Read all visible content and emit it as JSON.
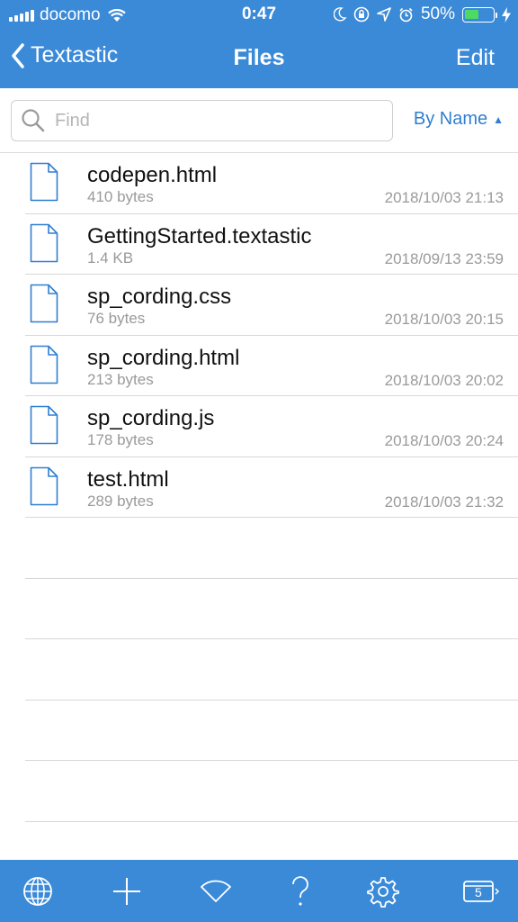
{
  "status": {
    "carrier": "docomo",
    "time": "0:47",
    "battery_percent": "50%",
    "battery_level": 0.5
  },
  "nav": {
    "back_label": "Textastic",
    "title": "Files",
    "edit_label": "Edit"
  },
  "search": {
    "placeholder": "Find",
    "value": ""
  },
  "sort": {
    "label": "By Name",
    "direction_icon": "▲"
  },
  "files": [
    {
      "name": "codepen.html",
      "size": "410 bytes",
      "date": "2018/10/03 21:13"
    },
    {
      "name": "GettingStarted.textastic",
      "size": "1.4 KB",
      "date": "2018/09/13 23:59"
    },
    {
      "name": "sp_cording.css",
      "size": "76 bytes",
      "date": "2018/10/03 20:15"
    },
    {
      "name": "sp_cording.html",
      "size": "213 bytes",
      "date": "2018/10/03 20:02"
    },
    {
      "name": "sp_cording.js",
      "size": "178 bytes",
      "date": "2018/10/03 20:24"
    },
    {
      "name": "test.html",
      "size": "289 bytes",
      "date": "2018/10/03 21:32"
    }
  ],
  "toolbar": {
    "items": [
      "globe-icon",
      "plus-icon",
      "wifi-icon",
      "help-icon",
      "gear-icon",
      "tabs-icon"
    ],
    "tabs_count": "5"
  },
  "colors": {
    "bar": "#3b8ad8",
    "accent": "#2f7fd1",
    "battery": "#4cd964"
  }
}
